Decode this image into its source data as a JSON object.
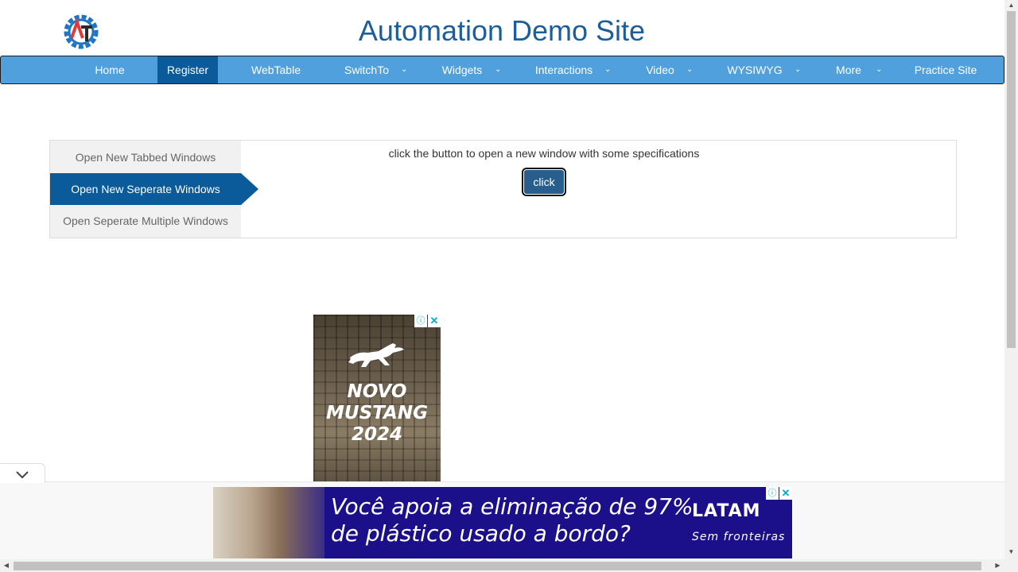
{
  "header": {
    "title": "Automation Demo Site"
  },
  "nav": {
    "items": [
      {
        "label": "Home"
      },
      {
        "label": "Register"
      },
      {
        "label": "WebTable"
      },
      {
        "label": "SwitchTo"
      },
      {
        "label": "Widgets"
      },
      {
        "label": "Interactions"
      },
      {
        "label": "Video"
      },
      {
        "label": "WYSIWYG"
      },
      {
        "label": "More"
      },
      {
        "label": "Practice Site"
      }
    ],
    "active": "Register",
    "colors": {
      "bar": "#4fa0dc",
      "active": "#0b5a99"
    }
  },
  "tabs": {
    "items": [
      {
        "label": "Open New Tabbed Windows"
      },
      {
        "label": "Open New Seperate Windows"
      },
      {
        "label": "Open Seperate Multiple Windows"
      }
    ],
    "active": "Open New Seperate Windows"
  },
  "content": {
    "instruction": "click the button to open a new window with some specifications",
    "button_label": "click"
  },
  "ads": {
    "side": {
      "lines": [
        "NOVO",
        "MUSTANG",
        "2024"
      ],
      "choice_icon": "info-icon",
      "close_icon": "close-icon"
    },
    "bottom": {
      "line1": "Você apoia a eliminação de 97%",
      "line2": "de plástico usado a bordo?",
      "brand": "LATAM",
      "tagline": "Sem fronteiras",
      "choice_icon": "info-icon",
      "close_icon": "close-icon"
    }
  }
}
